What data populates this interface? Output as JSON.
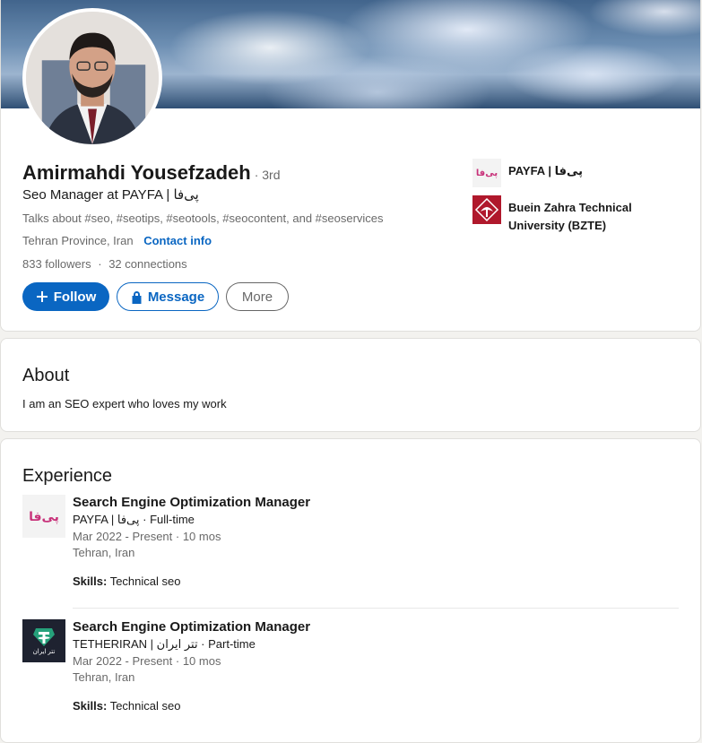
{
  "profile": {
    "name": "Amirmahdi Yousefzadeh",
    "degree": "· 3rd",
    "headline": "Seo Manager at PAYFA | پی‌فا",
    "talks_about": "Talks about #seo, #seotips, #seotools, #seocontent, and #seoservices",
    "location": "Tehran Province, Iran",
    "contact_info": "Contact info",
    "followers": "833 followers",
    "connections": "32 connections",
    "separator": "·"
  },
  "actions": {
    "follow": "Follow",
    "message": "Message",
    "more": "More"
  },
  "companies": [
    {
      "name": "PAYFA | پی‌فا",
      "logo_text": "پی‌فا"
    },
    {
      "name": "Buein Zahra Technical University (BZTE)"
    }
  ],
  "about": {
    "title": "About",
    "text": "I am an SEO expert who loves my work"
  },
  "experience": {
    "title": "Experience",
    "items": [
      {
        "role": "Search Engine Optimization Manager",
        "company": "PAYFA | پی‌فا · Full-time",
        "dates": "Mar 2022 - Present · 10 mos",
        "location": "Tehran, Iran",
        "skills_label": "Skills:",
        "skills": "Technical seo",
        "logo_text": "پی‌فا"
      },
      {
        "role": "Search Engine Optimization Manager",
        "company": "TETHERIRAN | تتر ایران · Part-time",
        "dates": "Mar 2022 - Present · 10 mos",
        "location": "Tehran, Iran",
        "skills_label": "Skills:",
        "skills": "Technical seo",
        "logo_text": "تتر ایران"
      }
    ]
  },
  "colors": {
    "accent": "#0a66c2",
    "payfa_brand": "#c8327a",
    "tether_green": "#26a17b",
    "university_red": "#b0182c"
  },
  "icons": {
    "follow": "plus-icon",
    "message": "lock-icon"
  }
}
